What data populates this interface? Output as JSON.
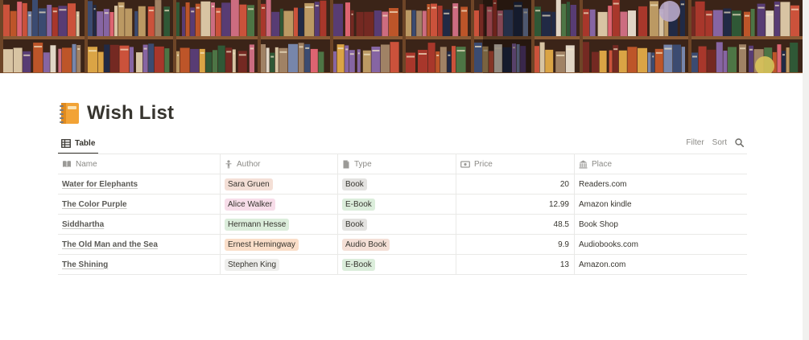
{
  "page": {
    "title": "Wish List",
    "icon": "notebook-icon"
  },
  "view": {
    "tab_label": "Table",
    "filter_label": "Filter",
    "sort_label": "Sort"
  },
  "table": {
    "columns": {
      "name": "Name",
      "author": "Author",
      "type": "Type",
      "price": "Price",
      "place": "Place"
    },
    "rows": [
      {
        "name": "Water for Elephants",
        "author": "Sara Gruen",
        "author_color": "#f4dfd6",
        "type": "Book",
        "type_color": "#e3e2e0",
        "price": "20",
        "place": "Readers.com"
      },
      {
        "name": "The Color Purple",
        "author": "Alice Walker",
        "author_color": "#f7dde9",
        "type": "E-Book",
        "type_color": "#dbeddb",
        "price": "12.99",
        "place": "Amazon kindle"
      },
      {
        "name": "Siddhartha",
        "author": "Hermann Hesse",
        "author_color": "#dbeddb",
        "type": "Book",
        "type_color": "#e3e2e0",
        "price": "48.5",
        "place": "Book Shop"
      },
      {
        "name": "The Old Man and the Sea",
        "author": "Ernest Hemingway",
        "author_color": "#fadec9",
        "type": "Audio Book",
        "type_color": "#f4dfd6",
        "price": "9.9",
        "place": "Audiobooks.com"
      },
      {
        "name": "The Shining",
        "author": "Stephen King",
        "author_color": "#eeeeec",
        "type": "E-Book",
        "type_color": "#dbeddb",
        "price": "13",
        "place": "Amazon.com"
      }
    ]
  },
  "colors": {
    "text": "#37352f",
    "muted": "#8b8a86",
    "divider": "#e9e9e7"
  }
}
